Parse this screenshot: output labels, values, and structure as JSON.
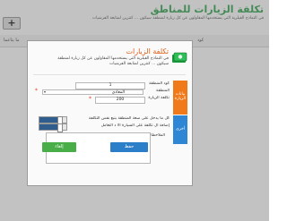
{
  "background": {
    "title": "تكلفة الزيارات للمناطق",
    "description": "في النماذج الفيلرية التي يستخدمها المقاولون عن كل زيارة لمنطقة سيكون ... كنترين لمتابعة الفرشيات",
    "add_label": "+",
    "columns": [
      "ما يتاعما",
      "كود"
    ]
  },
  "modal": {
    "title": "تكلفة الزيارات",
    "description": "في النماذج الفيلرية التي يستخدمها المقاولون عن كل زيارة لمنطقة سيكون ... كنترين لمتابعة الفرشيات",
    "sections": {
      "visit_data": "بيانات الزيارة",
      "other": "أخرى"
    },
    "fields": {
      "code_label": "كود المنطقة",
      "code_value": "1",
      "region_label": "المنطقة",
      "region_value": "المعادي",
      "cost_label": "تكلفة الزيارة",
      "cost_value": "200",
      "toggle1_label": "كل ما يدخل على سعة المنطقة يتبع نفس التكلفة",
      "toggle2_label": "إضافة ال تكلفة على السيارة ألا د التعامل",
      "notes_label": "الملاحظات"
    },
    "buttons": {
      "save": "حفظ",
      "cancel": "إلغاء"
    }
  },
  "colors": {
    "accent_orange": "#e05d12",
    "section_orange": "#f07a1a",
    "section_blue": "#2e86d4",
    "save_blue": "#2b7fc8",
    "cancel_green": "#49ad48",
    "icon_green": "#1a9a3c"
  }
}
